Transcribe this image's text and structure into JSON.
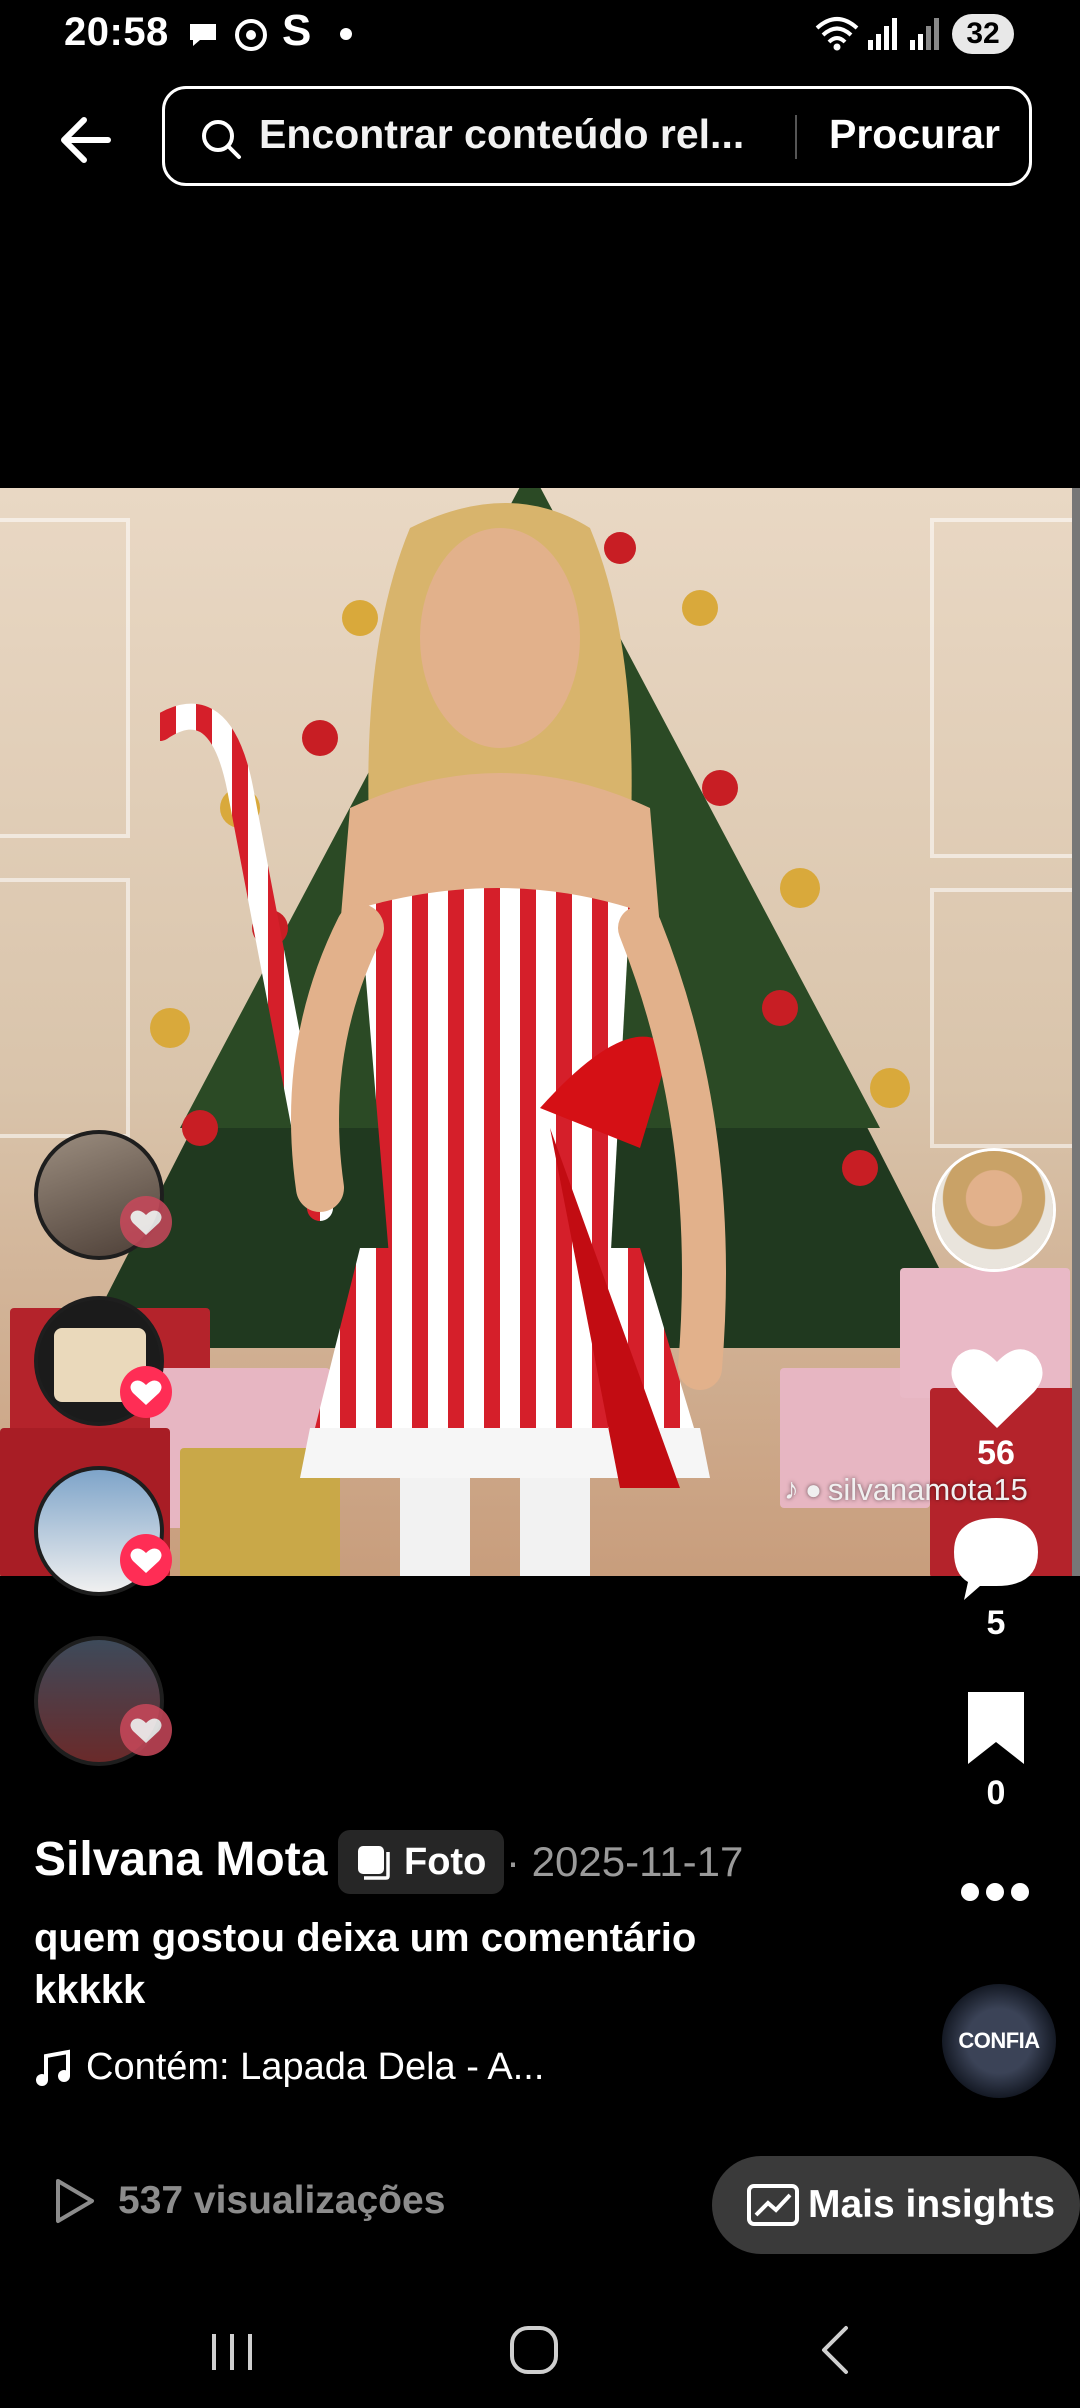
{
  "status": {
    "time": "20:58",
    "battery": "32"
  },
  "search": {
    "query": "Encontrar conteúdo rel...",
    "button": "Procurar"
  },
  "photo": {
    "watermark": "silvanamota15"
  },
  "actions": {
    "likes": "56",
    "comments": "5",
    "saves": "0"
  },
  "post": {
    "author": "Silvana Mota",
    "type": "Foto",
    "date": "· 2025-11-17",
    "caption": "quem gostou deixa um comentário kkkkk",
    "music": "Contém: Lapada Dela - A...",
    "views": "537 visualizações",
    "insights_button": "Mais insights"
  },
  "music_disc_label": "CONFIA",
  "colors": {
    "accent_red": "#ff2d55",
    "chip_bg": "#262626",
    "insights_bg": "#3a3a3a"
  }
}
